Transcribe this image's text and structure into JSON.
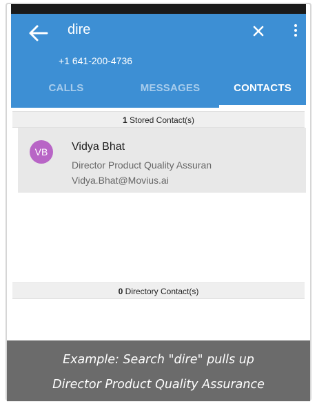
{
  "search": {
    "query": "dire",
    "phone_number": "+1 641-200-4736"
  },
  "tabs": [
    {
      "label": "CALLS",
      "active": false
    },
    {
      "label": "MESSAGES",
      "active": false
    },
    {
      "label": "CONTACTS",
      "active": true
    }
  ],
  "stored_section": {
    "count": "1",
    "label": " Stored Contact(s)"
  },
  "contact": {
    "initials": "VB",
    "name": "Vidya Bhat",
    "title": "Director Product Quality Assuran",
    "email": "Vidya.Bhat@Movius.ai"
  },
  "directory_section": {
    "count": "0",
    "label": " Directory Contact(s)"
  },
  "caption": {
    "line1": "Example: Search \"dire\" pulls up",
    "line2": "Director Product Quality Assurance"
  },
  "colors": {
    "appbar": "#3d8fd4",
    "avatar": "#b865c6",
    "caption_bg": "#6b6b6b"
  },
  "icons": {
    "back": "arrow-left-icon",
    "clear": "close-icon",
    "more": "more-vertical-icon"
  }
}
